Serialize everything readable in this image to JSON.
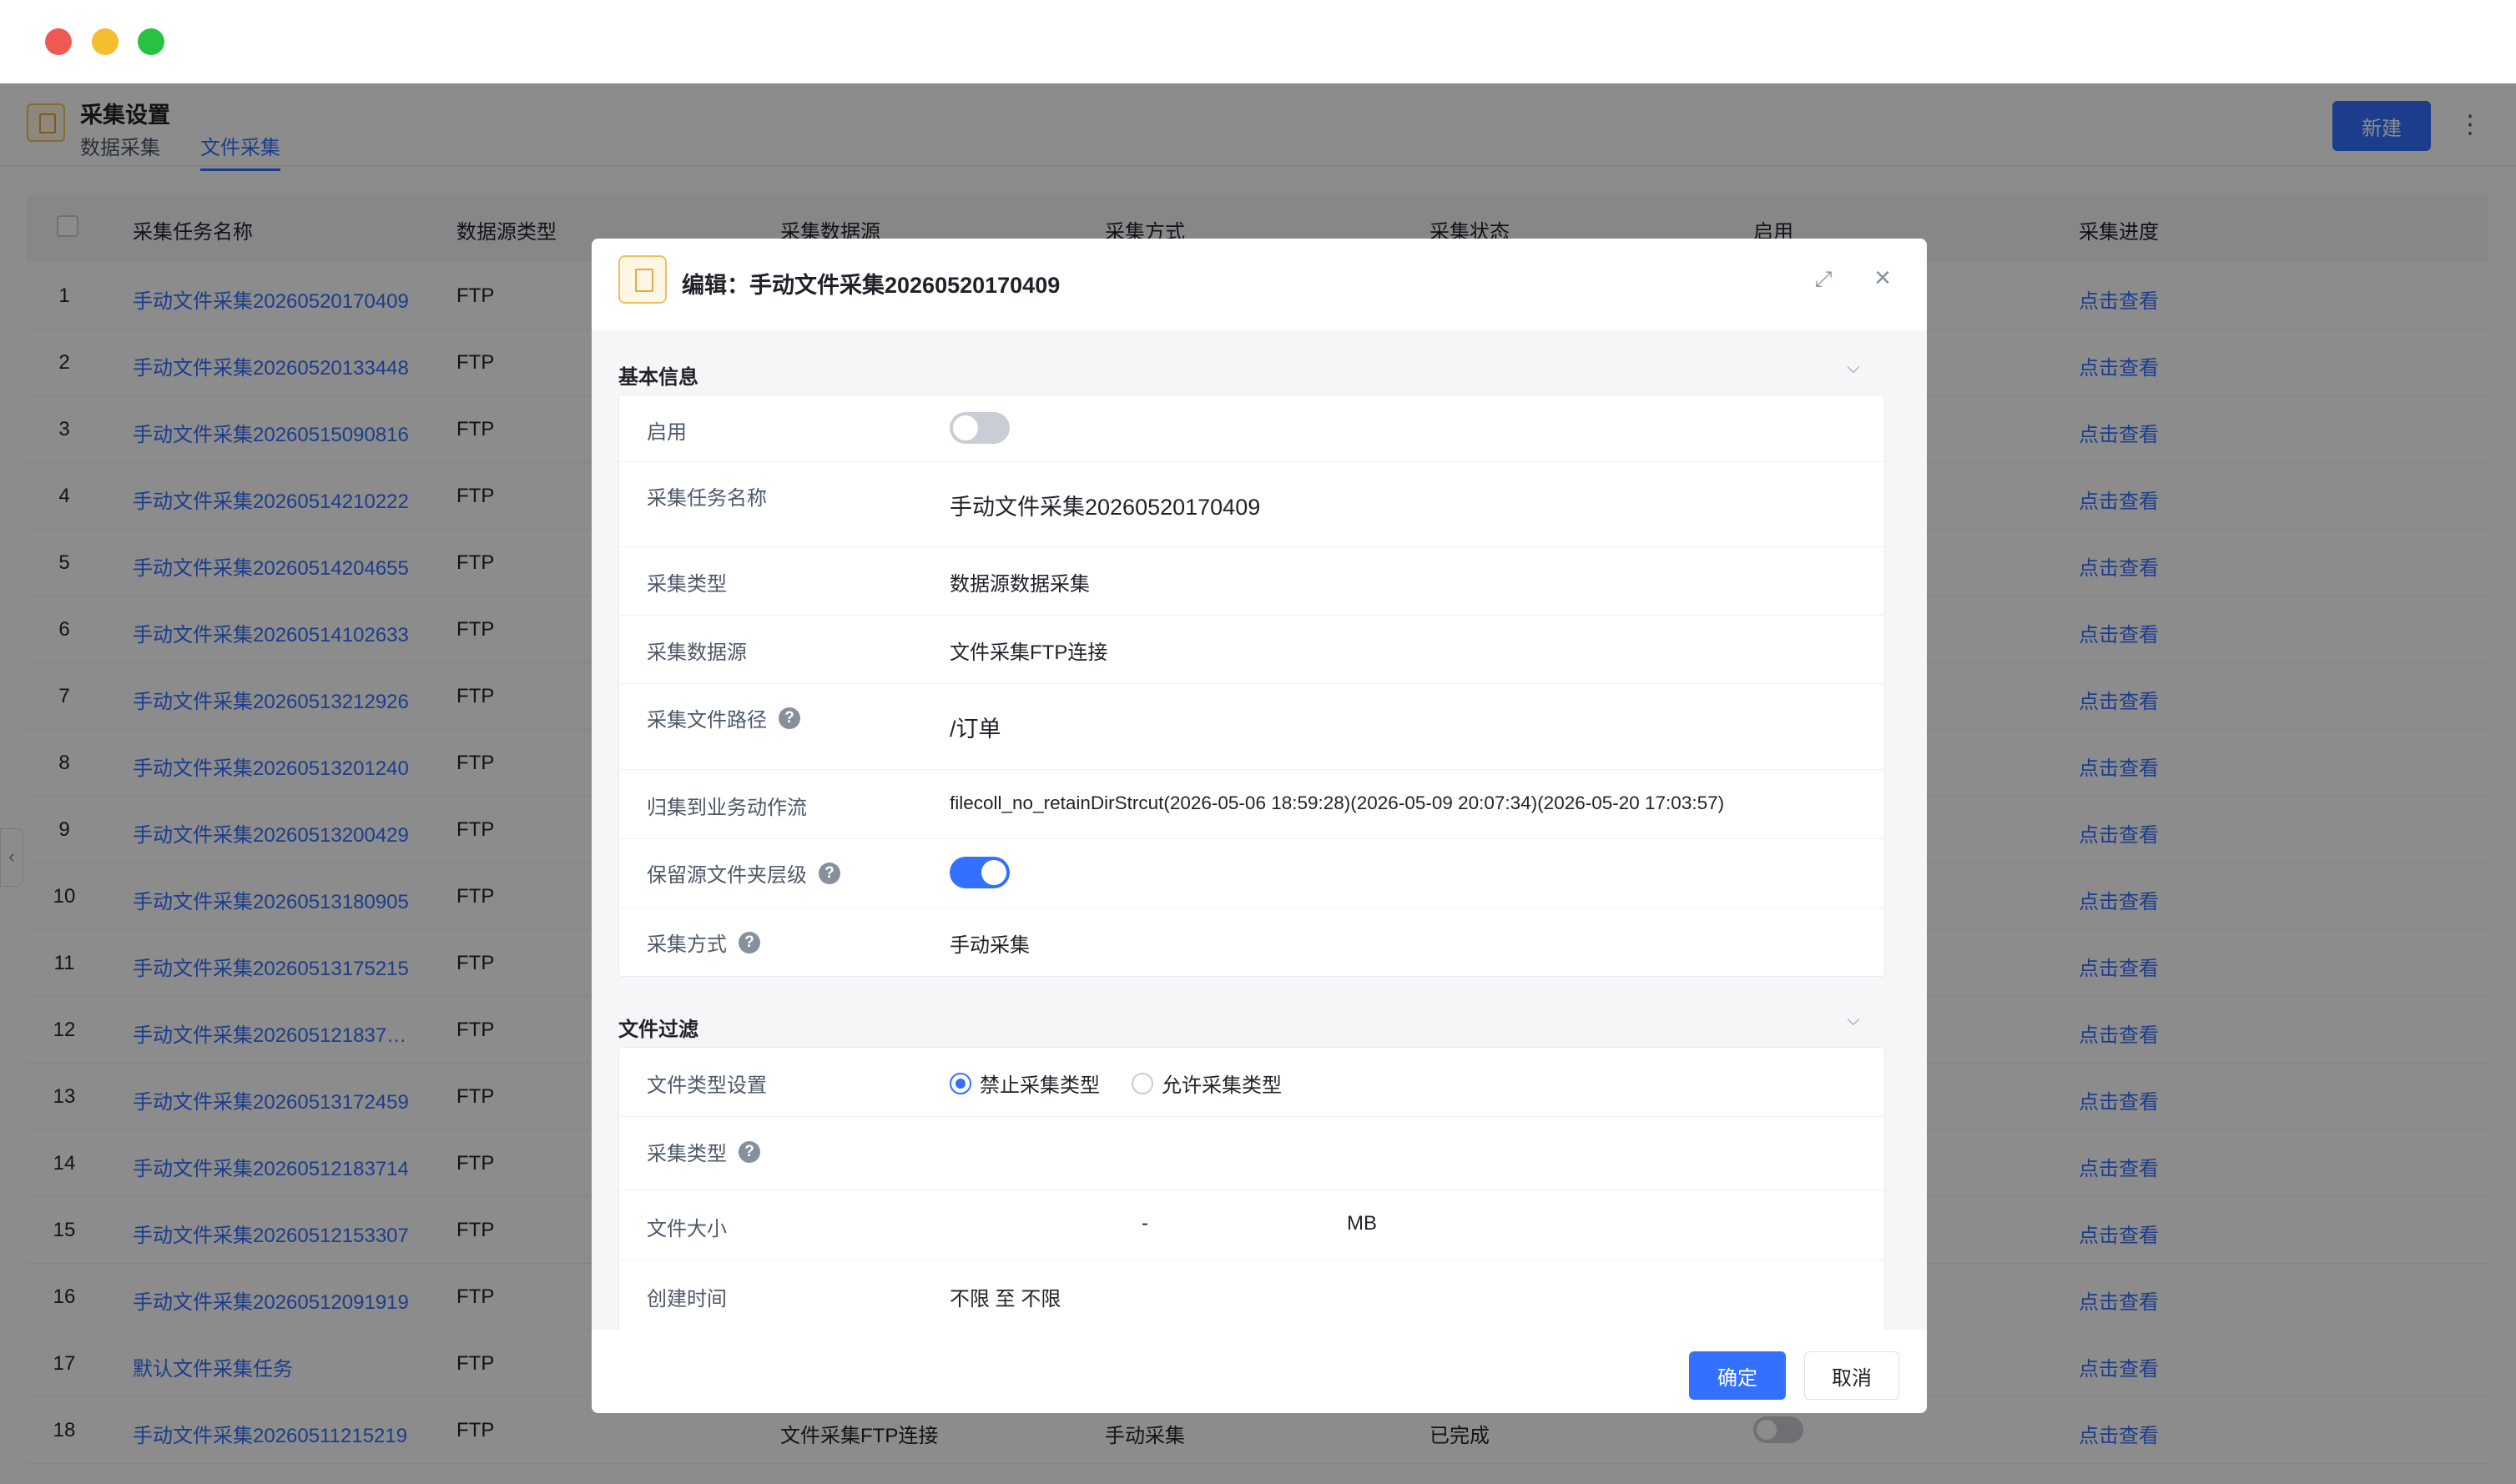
{
  "header": {
    "title": "采集设置",
    "tabs": [
      "数据采集",
      "文件采集"
    ],
    "new_label": "新建",
    "more_icon": "more-vertical-icon"
  },
  "table": {
    "columns": [
      "采集任务名称",
      "数据源类型",
      "采集数据源",
      "采集方式",
      "采集状态",
      "启用",
      "采集进度"
    ],
    "rows": [
      {
        "idx": "1",
        "name": "手动文件采集20260520170409",
        "type": "FTP",
        "source": "",
        "mode": "",
        "state": "",
        "view": "点击查看"
      },
      {
        "idx": "2",
        "name": "手动文件采集20260520133448",
        "type": "FTP",
        "source": "",
        "mode": "",
        "state": "",
        "view": "点击查看"
      },
      {
        "idx": "3",
        "name": "手动文件采集20260515090816",
        "type": "FTP",
        "source": "",
        "mode": "",
        "state": "",
        "view": "点击查看"
      },
      {
        "idx": "4",
        "name": "手动文件采集20260514210222",
        "type": "FTP",
        "source": "",
        "mode": "",
        "state": "",
        "view": "点击查看"
      },
      {
        "idx": "5",
        "name": "手动文件采集20260514204655",
        "type": "FTP",
        "source": "",
        "mode": "",
        "state": "",
        "view": "点击查看"
      },
      {
        "idx": "6",
        "name": "手动文件采集20260514102633",
        "type": "FTP",
        "source": "",
        "mode": "",
        "state": "",
        "view": "点击查看"
      },
      {
        "idx": "7",
        "name": "手动文件采集20260513212926",
        "type": "FTP",
        "source": "",
        "mode": "",
        "state": "",
        "view": "点击查看"
      },
      {
        "idx": "8",
        "name": "手动文件采集20260513201240",
        "type": "FTP",
        "source": "",
        "mode": "",
        "state": "",
        "view": "点击查看"
      },
      {
        "idx": "9",
        "name": "手动文件采集20260513200429",
        "type": "FTP",
        "source": "",
        "mode": "",
        "state": "",
        "view": "点击查看"
      },
      {
        "idx": "10",
        "name": "手动文件采集20260513180905",
        "type": "FTP",
        "source": "",
        "mode": "",
        "state": "",
        "view": "点击查看"
      },
      {
        "idx": "11",
        "name": "手动文件采集20260513175215",
        "type": "FTP",
        "source": "",
        "mode": "",
        "state": "",
        "view": "点击查看"
      },
      {
        "idx": "12",
        "name": "手动文件采集202605121837…",
        "type": "FTP",
        "source": "",
        "mode": "",
        "state": "",
        "view": "点击查看"
      },
      {
        "idx": "13",
        "name": "手动文件采集20260513172459",
        "type": "FTP",
        "source": "",
        "mode": "",
        "state": "",
        "view": "点击查看"
      },
      {
        "idx": "14",
        "name": "手动文件采集20260512183714",
        "type": "FTP",
        "source": "",
        "mode": "",
        "state": "",
        "view": "点击查看"
      },
      {
        "idx": "15",
        "name": "手动文件采集20260512153307",
        "type": "FTP",
        "source": "",
        "mode": "",
        "state": "",
        "view": "点击查看"
      },
      {
        "idx": "16",
        "name": "手动文件采集20260512091919",
        "type": "FTP",
        "source": "",
        "mode": "",
        "state": "",
        "view": "点击查看"
      },
      {
        "idx": "17",
        "name": "默认文件采集任务",
        "type": "FTP",
        "source": "",
        "mode": "",
        "state": "",
        "view": "点击查看"
      },
      {
        "idx": "18",
        "name": "手动文件采集20260511215219",
        "type": "FTP",
        "source": "文件采集FTP连接",
        "mode": "手动采集",
        "state": "已完成",
        "view": "点击查看"
      }
    ]
  },
  "dialog": {
    "title": "编辑：手动文件采集20260520170409",
    "expand_icon": "expand-icon",
    "close_icon": "close-icon",
    "basic": {
      "title": "基本信息",
      "enabled_label": "启用",
      "enabled": false,
      "name_label": "采集任务名称",
      "name_value": "手动文件采集20260520170409",
      "collect_type_label": "采集类型",
      "collect_type_value": "数据源数据采集",
      "source_label": "采集数据源",
      "source_value": "文件采集FTP连接",
      "path_label": "采集文件路径",
      "path_value": "/订单",
      "flow_label": "归集到业务动作流",
      "flow_value": "filecoll_no_retainDirStrcut(2026-05-06 18:59:28)(2026-05-09 20:07:34)(2026-05-20 17:03:57)",
      "keep_dir_label": "保留源文件夹层级",
      "keep_dir": true,
      "mode_label": "采集方式",
      "mode_value": "手动采集"
    },
    "filter": {
      "title": "文件过滤",
      "filetype_label": "文件类型设置",
      "radio_options": [
        "禁止采集类型",
        "允许采集类型"
      ],
      "radio_selected": "禁止采集类型",
      "collect_type_label": "采集类型",
      "size_label": "文件大小",
      "size_sep": "-",
      "size_unit": "MB",
      "ctime_label": "创建时间",
      "ctime_value": "不限 至 不限"
    },
    "ok_label": "确定",
    "cancel_label": "取消"
  },
  "colors": {
    "accent": "#3370ff",
    "mask": "rgba(0,0,0,0.45)"
  }
}
